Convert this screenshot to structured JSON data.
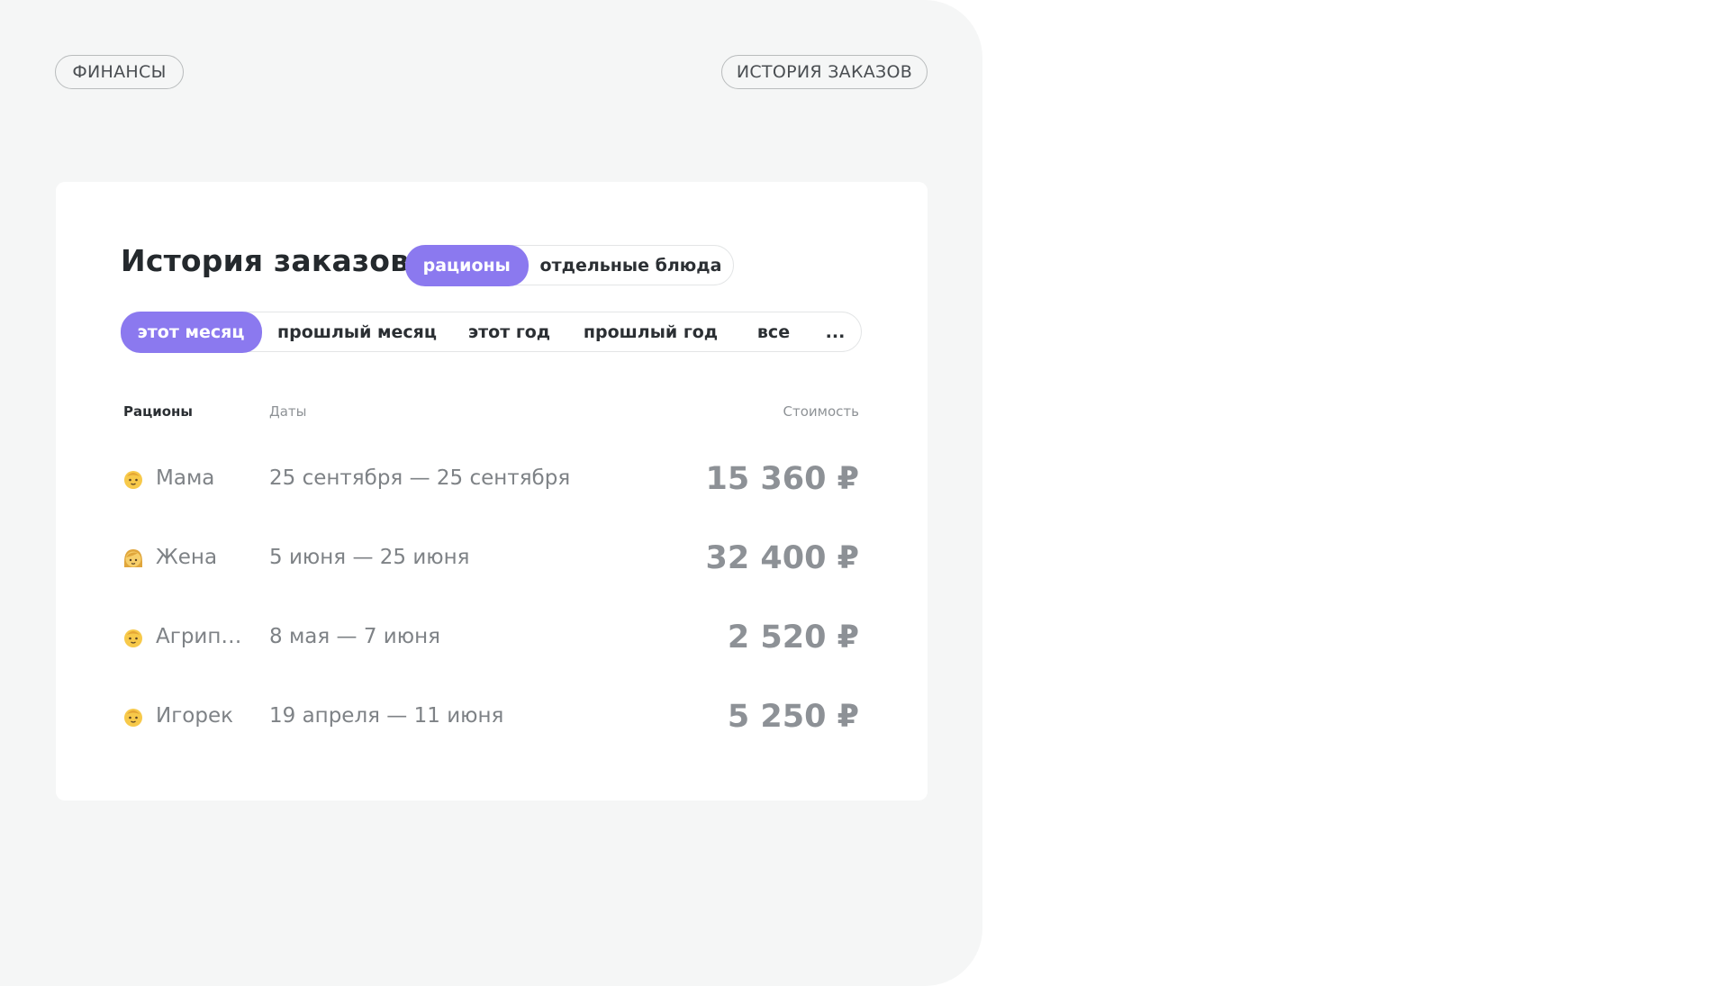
{
  "breadcrumbs": {
    "left": "ФИНАНСЫ",
    "right": "ИСТОРИЯ ЗАКАЗОВ"
  },
  "card": {
    "title": "История заказов",
    "type_tabs": [
      {
        "label": "рационы",
        "active": true
      },
      {
        "label": "отдельные блюда",
        "active": false
      }
    ],
    "period_tabs": [
      {
        "label": "этот месяц",
        "active": true
      },
      {
        "label": "прошлый месяц",
        "active": false
      },
      {
        "label": "этот год",
        "active": false
      },
      {
        "label": "прошлый год",
        "active": false
      },
      {
        "label": "все",
        "active": false
      },
      {
        "label": "...",
        "active": false
      }
    ],
    "columns": {
      "rations": "Рационы",
      "dates": "Даты",
      "cost": "Стоимость"
    },
    "rows": [
      {
        "icon": "baby-face-icon",
        "name": "Мама",
        "dates": "25 сентября — 25 сентября",
        "price": "15 360 ₽"
      },
      {
        "icon": "girl-face-icon",
        "name": "Жена",
        "dates": "5 июня — 25 июня",
        "price": "32 400 ₽"
      },
      {
        "icon": "baby-face-icon",
        "name": "Агрипи...",
        "dates": "8 мая — 7 июня",
        "price": "2 520 ₽"
      },
      {
        "icon": "baby-face-icon",
        "name": "Игорек",
        "dates": "19 апреля — 11 июня",
        "price": "5 250 ₽"
      }
    ]
  },
  "colors": {
    "accent": "#8b79ef",
    "panel_bg": "#f5f6f6",
    "card_bg": "#ffffff",
    "muted_text": "#7e8286"
  }
}
